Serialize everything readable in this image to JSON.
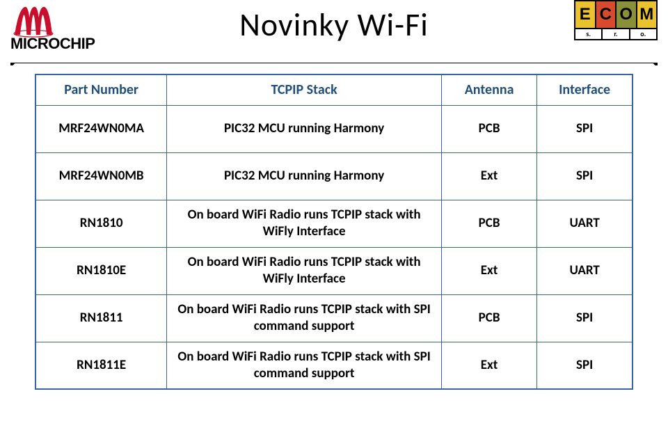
{
  "title": "Novinky Wi-Fi",
  "logos": {
    "left_name": "MICROCHIP",
    "right_letters": [
      "E",
      "C",
      "O",
      "M"
    ],
    "right_sub": [
      "s.",
      "r.",
      "o."
    ]
  },
  "table": {
    "headers": [
      "Part Number",
      "TCPIP Stack",
      "Antenna",
      "Interface"
    ],
    "rows": [
      {
        "part": "MRF24WN0MA",
        "stack": "PIC32 MCU running Harmony",
        "antenna": "PCB",
        "interface": "SPI"
      },
      {
        "part": "MRF24WN0MB",
        "stack": "PIC32 MCU running Harmony",
        "antenna": "Ext",
        "interface": "SPI"
      },
      {
        "part": "RN1810",
        "stack": "On board WiFi Radio runs TCPIP stack with WiFly Interface",
        "antenna": "PCB",
        "interface": "UART"
      },
      {
        "part": "RN1810E",
        "stack": "On board WiFi Radio runs TCPIP stack with WiFly Interface",
        "antenna": "Ext",
        "interface": "UART"
      },
      {
        "part": "RN1811",
        "stack": "On board  WiFi Radio runs TCPIP stack with SPI command support",
        "antenna": "PCB",
        "interface": "SPI"
      },
      {
        "part": "RN1811E",
        "stack": "On board  WiFi Radio runs TCPIP stack with SPI command support",
        "antenna": "Ext",
        "interface": "SPI"
      }
    ]
  }
}
